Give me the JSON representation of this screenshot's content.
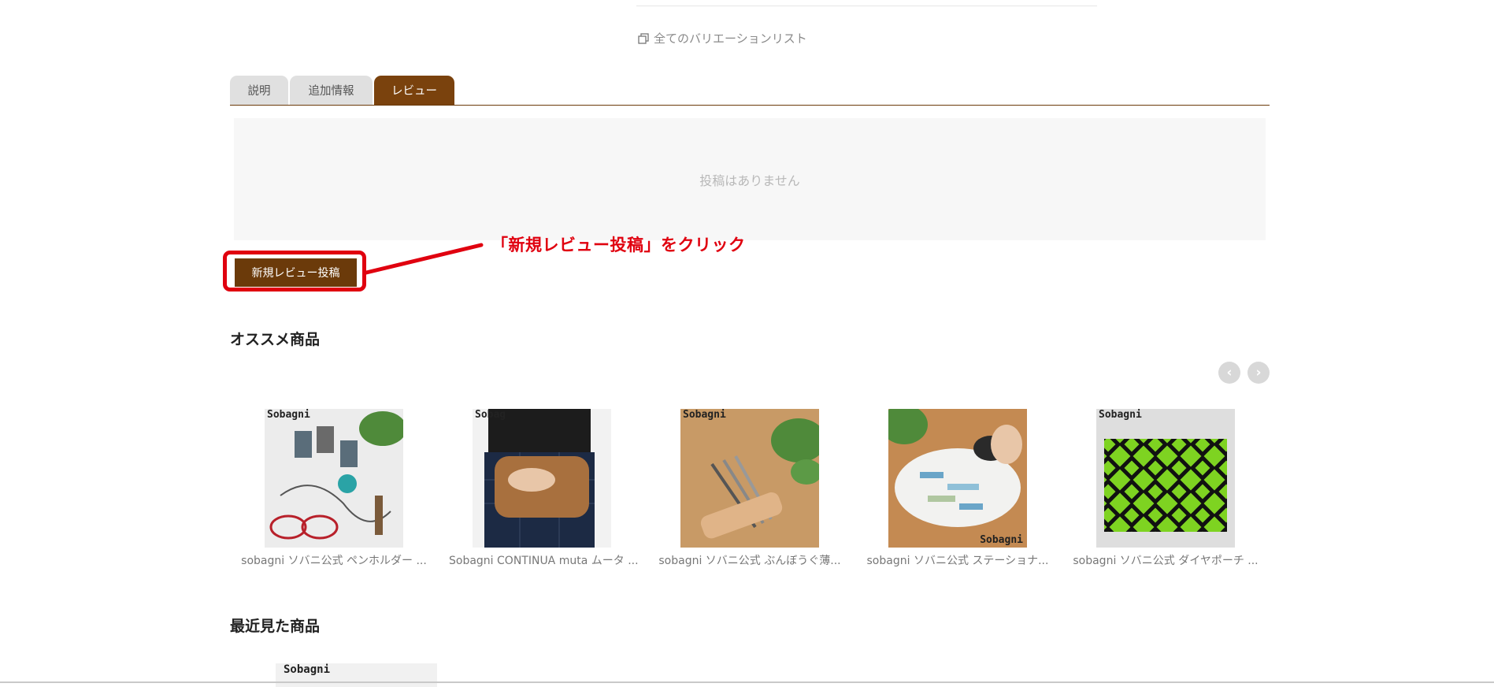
{
  "variation_link": {
    "label": "全てのバリエーションリスト",
    "icon": "copy-icon"
  },
  "tabs": [
    {
      "label": "説明",
      "active": false
    },
    {
      "label": "追加情報",
      "active": false
    },
    {
      "label": "レビュー",
      "active": true
    }
  ],
  "reviews": {
    "empty_message": "投稿はありません"
  },
  "new_review_button": {
    "label": "新規レビュー投稿"
  },
  "annotation": {
    "text": "「新規レビュー投稿」をクリック",
    "color": "#e0000f"
  },
  "recommended": {
    "title": "オススメ商品",
    "prev_icon": "chevron-left-icon",
    "next_icon": "chevron-right-icon",
    "products": [
      {
        "brand": "Sobagni",
        "name": "sobagni ソバニ公式 ペンホルダー ..."
      },
      {
        "brand": "Sobag",
        "name": "Sobagni CONTINUA muta ムータ ..."
      },
      {
        "brand": "Sobagni",
        "name": "sobagni ソバニ公式 ぶんぼうぐ薄..."
      },
      {
        "brand": "Sobagni",
        "name": "sobagni ソバニ公式 ステーショナ..."
      },
      {
        "brand": "Sobagni",
        "name": "sobagni ソバニ公式 ダイヤポーチ ..."
      }
    ]
  },
  "recently_viewed": {
    "title": "最近見た商品",
    "brand": "Sobagni"
  },
  "colors": {
    "accent_brown": "#7a420d",
    "button_brown": "#6b3a0a"
  }
}
